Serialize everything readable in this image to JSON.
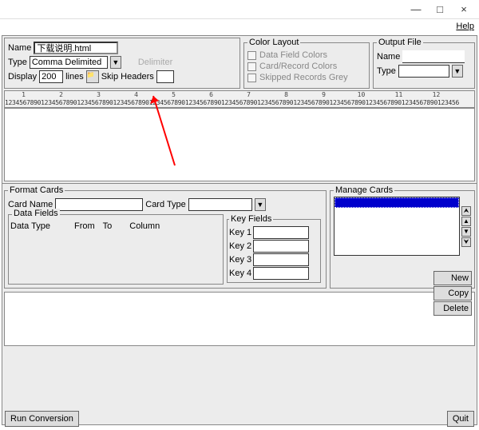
{
  "titlebar": {
    "minimize": "—",
    "maximize": "□",
    "close": "×"
  },
  "menubar": {
    "help": "Help"
  },
  "namePanel": {
    "nameLabel": "Name",
    "nameValue": "下载说明.html",
    "typeLabel": "Type",
    "typeValue": "Comma Delimited",
    "displayLabel": "Display",
    "displayValue": "200",
    "linesLabel": "lines",
    "delimiterLabel": "Delimiter",
    "skipLabel": "Skip Headers",
    "skipValue": ""
  },
  "colorLayout": {
    "legend": "Color Layout",
    "opt1": "Data Field Colors",
    "opt2": "Card/Record Colors",
    "opt3": "Skipped Records Grey"
  },
  "outputFile": {
    "legend": "Output File",
    "nameLabel": "Name",
    "nameValue": "",
    "typeLabel": "Type",
    "typeValue": ""
  },
  "ruler": {
    "ticks": [
      "1",
      "2",
      "3",
      "4",
      "5",
      "6",
      "7",
      "8",
      "9",
      "10",
      "11",
      "12"
    ],
    "digits": "123456789012345678901234567890123456789012345678901234567890123456789012345678901234567890123456789012345678901234567890123456"
  },
  "formatCards": {
    "legend": "Format Cards",
    "cardNameLabel": "Card Name",
    "cardNameValue": "",
    "cardTypeLabel": "Card Type",
    "cardTypeValue": ""
  },
  "dataFields": {
    "legend": "Data Fields",
    "col1": "Data Type",
    "col2": "From",
    "col3": "To",
    "col4": "Column"
  },
  "keyFields": {
    "legend": "Key Fields",
    "k1": "Key 1",
    "k2": "Key 2",
    "k3": "Key 3",
    "k4": "Key 4"
  },
  "manage": {
    "legend": "Manage Cards",
    "newBtn": "New",
    "copyBtn": "Copy",
    "deleteBtn": "Delete"
  },
  "footer": {
    "run": "Run Conversion",
    "quit": "Quit"
  }
}
